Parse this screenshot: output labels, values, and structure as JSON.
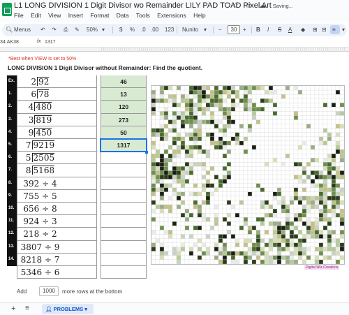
{
  "window": {
    "title": "L1 LONG DIVISION 1 Digit Divisor wo Remainder LILY PAD TOAD Pixel Art",
    "status": "Saving..."
  },
  "menu": [
    "File",
    "Edit",
    "View",
    "Insert",
    "Format",
    "Data",
    "Tools",
    "Extensions",
    "Help"
  ],
  "toolbar": {
    "menus_label": "Menus",
    "zoom": "50%",
    "currency": "$",
    "percent": "%",
    "dec_decrease": ".0",
    "dec_increase": ".00",
    "number_format": "123",
    "font": "Nunito",
    "font_size": "30",
    "bold": "B",
    "italic": "I",
    "strike": "S",
    "text_color": "A"
  },
  "formula_bar": {
    "name_box": "34:AK38",
    "fx": "fx",
    "value": "1317"
  },
  "sheet": {
    "note": "*Best when VIEW is set to 50%",
    "instruction": "LONG DIVISION 1 Digit Divisor without Remainder:  Find the quotient.",
    "rows": [
      {
        "num": "Ex.",
        "type": "long",
        "divisor": "2",
        "dividend": "92",
        "answer": "46"
      },
      {
        "num": "1.",
        "type": "long",
        "divisor": "6",
        "dividend": "78",
        "answer": "13"
      },
      {
        "num": "2.",
        "type": "long",
        "divisor": "4",
        "dividend": "480",
        "answer": "120"
      },
      {
        "num": "3.",
        "type": "long",
        "divisor": "3",
        "dividend": "819",
        "answer": "273"
      },
      {
        "num": "4.",
        "type": "long",
        "divisor": "9",
        "dividend": "450",
        "answer": "50"
      },
      {
        "num": "5.",
        "type": "long",
        "divisor": "7",
        "dividend": "9219",
        "answer": "1317"
      },
      {
        "num": "6.",
        "type": "long",
        "divisor": "5",
        "dividend": "2505",
        "answer": ""
      },
      {
        "num": "7.",
        "type": "long",
        "divisor": "8",
        "dividend": "5168",
        "answer": ""
      },
      {
        "num": "8.",
        "type": "inline",
        "text": "392 ÷ 4",
        "answer": ""
      },
      {
        "num": "9.",
        "type": "inline",
        "text": "755 ÷ 5",
        "answer": ""
      },
      {
        "num": "10.",
        "type": "inline",
        "text": "656 ÷ 8",
        "answer": ""
      },
      {
        "num": "11.",
        "type": "inline",
        "text": "924 ÷ 3",
        "answer": ""
      },
      {
        "num": "12.",
        "type": "inline",
        "text": "218 ÷ 2",
        "answer": ""
      },
      {
        "num": "13.",
        "type": "inline",
        "text": "3807 ÷ 9",
        "answer": ""
      },
      {
        "num": "14.",
        "type": "inline",
        "text": "8218 ÷ 7",
        "answer": ""
      },
      {
        "num": "15.",
        "type": "inline",
        "text": "5346 ÷ 6",
        "answer": ""
      }
    ],
    "pixel_colors": [
      "#ffffff",
      "#e8ece8",
      "#c9d1c4",
      "#9aab86",
      "#6f8f4e",
      "#4a6b2e",
      "#2c3d1a",
      "#1a1f14",
      "#b7c99a",
      "#d8dfb8",
      "#c4c08a"
    ],
    "credit": "Digital Wiz Creations"
  },
  "bottom": {
    "add_label": "Add",
    "rows_value": "1000",
    "rows_suffix": "more rows at the bottom",
    "sheet_tab": "PROBLEMS",
    "plus": "+",
    "all_sheets": "≡"
  }
}
